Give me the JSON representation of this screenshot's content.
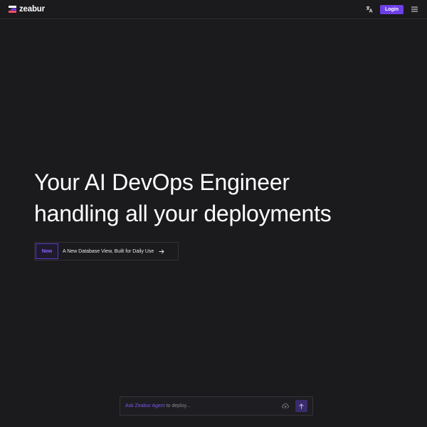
{
  "brand": {
    "name": "zeabur",
    "colors": {
      "top": "#ffffff",
      "middle": "#6d3fe6",
      "bottom": "#ff4d6a"
    }
  },
  "header": {
    "translate_icon": "translate-icon",
    "login_label": "Login",
    "menu_icon": "hamburger-menu-icon",
    "accent": "#6d3fe6"
  },
  "hero": {
    "title_line1": "Your AI DevOps Engineer",
    "title_line2": "handling all your deployments"
  },
  "announcement": {
    "badge": "New",
    "text": "A New Database View, Built for Daily Use",
    "arrow_icon": "arrow-right-icon"
  },
  "agent": {
    "highlight": "Ask Zeabur Agent",
    "placeholder_rest": " to deploy...",
    "attach_icon": "upload-cloud-icon",
    "send_icon": "arrow-up-icon"
  }
}
